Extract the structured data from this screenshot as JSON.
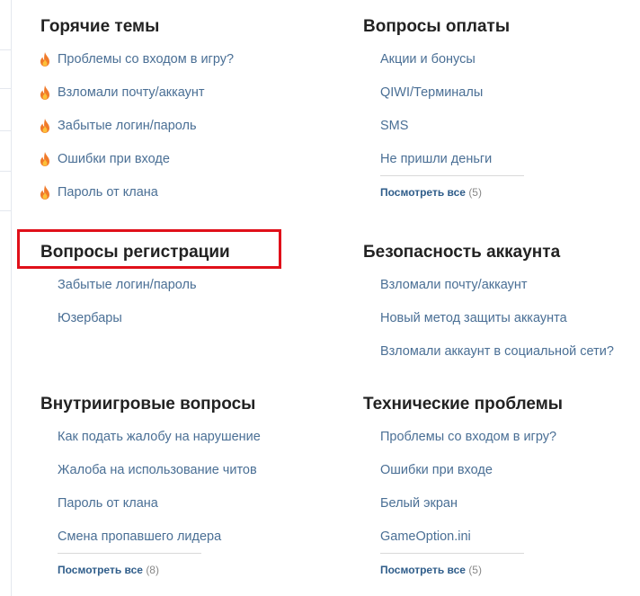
{
  "hot": {
    "title": "Горячие темы",
    "links": [
      "Проблемы со входом в игру?",
      "Взломали почту/аккаунт",
      "Забытые логин/пароль",
      "Ошибки при входе",
      "Пароль от клана"
    ]
  },
  "payment": {
    "title": "Вопросы оплаты",
    "links": [
      "Акции и бонусы",
      "QIWI/Терминалы",
      "SMS",
      "Не пришли деньги"
    ],
    "see_all": "Посмотреть все",
    "count": "(5)"
  },
  "registration": {
    "title": "Вопросы регистрации",
    "links": [
      "Забытые логин/пароль",
      "Юзербары"
    ]
  },
  "security": {
    "title": "Безопасность аккаунта",
    "links": [
      "Взломали почту/аккаунт",
      "Новый метод защиты аккаунта",
      "Взломали аккаунт в социальной сети?"
    ]
  },
  "ingame": {
    "title": "Внутриигровые вопросы",
    "links": [
      "Как подать жалобу на нарушение",
      "Жалоба на использование читов",
      "Пароль от клана",
      "Смена пропавшего лидера"
    ],
    "see_all": "Посмотреть все",
    "count": "(8)"
  },
  "tech": {
    "title": "Технические проблемы",
    "links": [
      "Проблемы со входом в игру?",
      "Ошибки при входе",
      "Белый экран",
      "GameOption.ini"
    ],
    "see_all": "Посмотреть все",
    "count": "(5)"
  },
  "icons": {
    "hot_topic": "fire-icon"
  },
  "colors": {
    "link": "#4a6f95",
    "highlight": "#e0101a",
    "heading": "#222222"
  }
}
